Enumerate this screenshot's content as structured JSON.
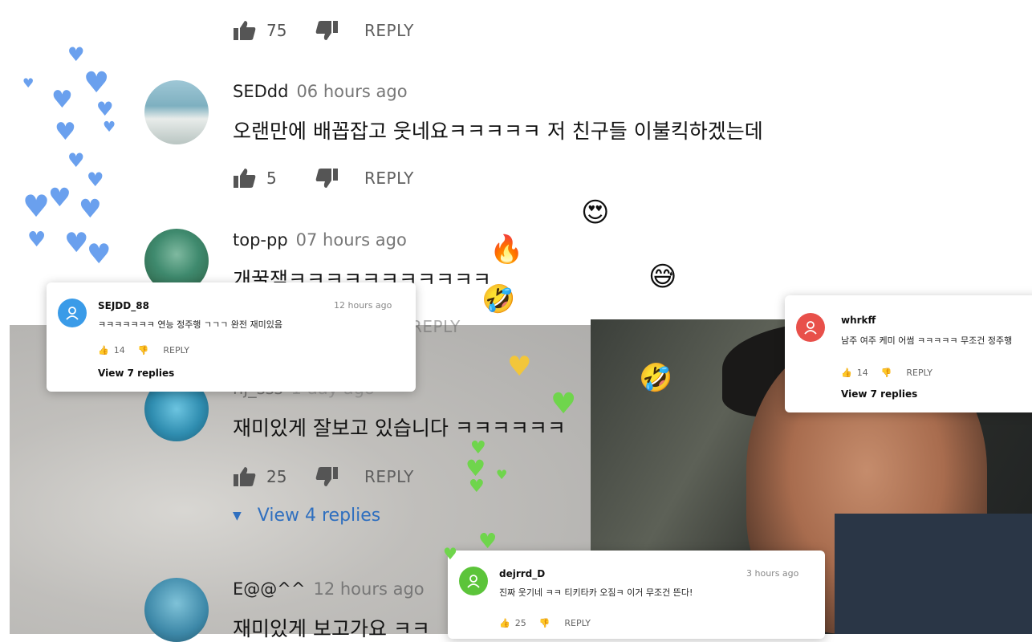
{
  "top_actions": {
    "like_count": "75",
    "reply_label": "REPLY"
  },
  "comments": [
    {
      "author": "SEDdd",
      "time": "06 hours ago",
      "text": "오랜만에 배꼽잡고 웃네요ㅋㅋㅋㅋㅋ 저 친구들 이불킥하겠는데",
      "likes": "5",
      "reply_label": "REPLY"
    },
    {
      "author": "top-pp",
      "time": "07 hours ago",
      "text": "개꿀잼ㅋㅋㅋㅋㅋㅋㅋㅋㅋㅋㅋ",
      "reply_label": "REPLY"
    },
    {
      "author": "hj_sss",
      "time": "1 day ago",
      "text": "재미있게 잘보고 있습니다 ㅋㅋㅋㅋㅋㅋ",
      "likes": "25",
      "reply_label": "REPLY",
      "view_replies": "View 4 replies"
    },
    {
      "author": "E@@^^",
      "time": "12 hours ago",
      "text": "재미있게 보고가요 ㅋㅋ"
    }
  ],
  "popups": [
    {
      "author": "SEJDD_88",
      "time": "12 hours ago",
      "text": "ㅋㅋㅋㅋㅋㅋㅋ 연능 정주행 ㄱㄱㄱ 완전 재미있음",
      "likes": "14",
      "reply_label": "REPLY",
      "view_replies": "View 7 replies",
      "avatar_color": "#3a9be8"
    },
    {
      "author": "whrkff",
      "text": "남주 여주 케미 어썸 ㅋㅋㅋㅋㅋ 무조건 정주행",
      "likes": "14",
      "reply_label": "REPLY",
      "view_replies": "View 7 replies",
      "avatar_color": "#e8504a"
    },
    {
      "author": "dejrrd_D",
      "time": "3 hours ago",
      "text": "진짜 웃기네 ㅋㅋ 티키타카 오짐ㅋ   이거 무조건 뜬다!",
      "likes": "25",
      "reply_label": "REPLY",
      "avatar_color": "#5cc43a"
    }
  ],
  "icons": [
    "thumb-up-icon",
    "thumb-down-icon",
    "chevron-down-icon",
    "person-icon",
    "heart-icon",
    "fire-emoji-icon",
    "laughing-emoji-icon"
  ]
}
